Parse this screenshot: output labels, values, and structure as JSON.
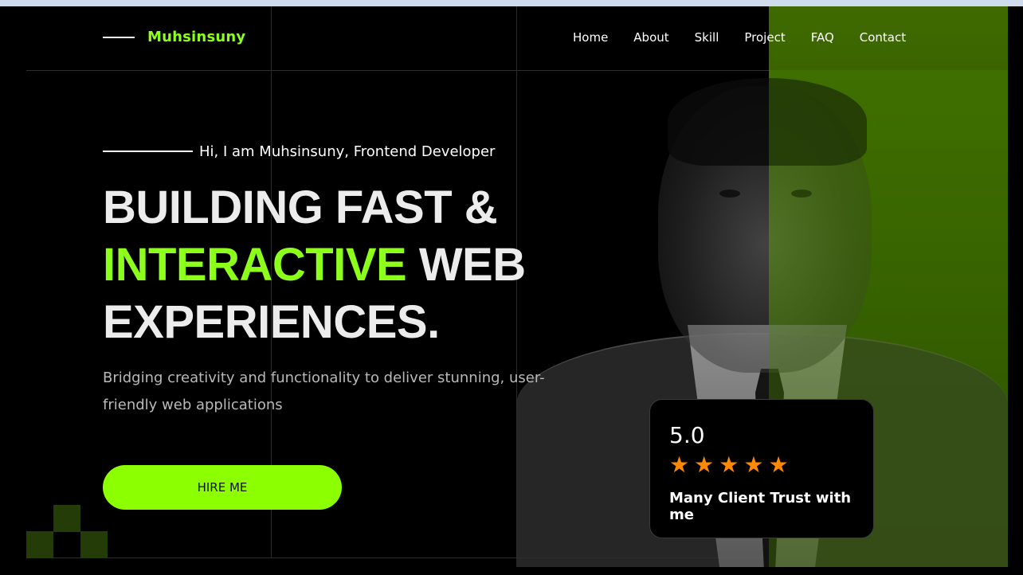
{
  "header": {
    "brand": "Muhsinsuny",
    "nav": [
      "Home",
      "About",
      "Skill",
      "Project",
      "FAQ",
      "Contact"
    ]
  },
  "hero": {
    "intro": "Hi, I am Muhsinsuny, Frontend Developer",
    "headline_line1": "BUILDING FAST &",
    "headline_accent": "INTERACTIVE",
    "headline_line2_rest": "WEB",
    "headline_line3": "EXPERIENCES.",
    "description": "Bridging creativity and functionality to deliver stunning, user-friendly web applications",
    "cta_label": "HIRE ME"
  },
  "rating_card": {
    "value": "5.0",
    "stars": 5,
    "caption": "Many Client Trust with me"
  },
  "colors": {
    "accent": "#8cff1a",
    "star": "#ff8a00",
    "background": "#000000"
  }
}
